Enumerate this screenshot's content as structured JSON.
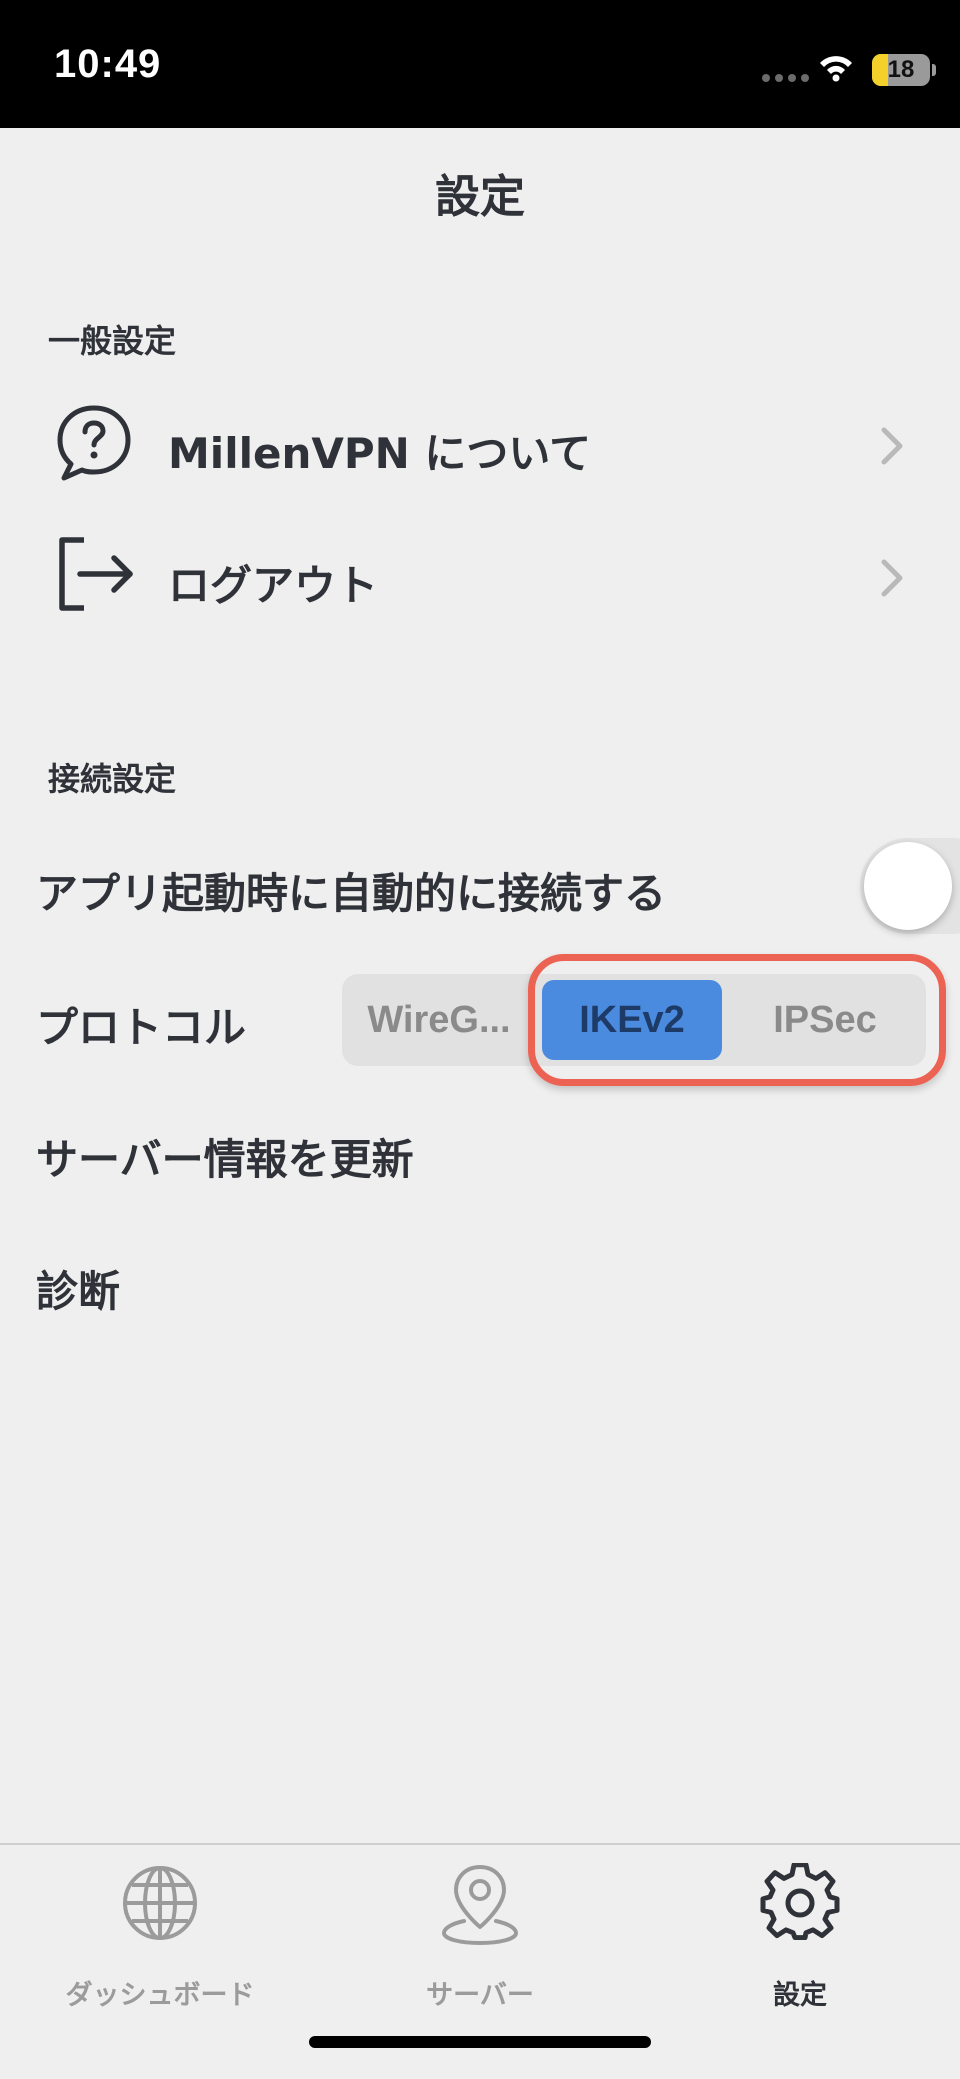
{
  "status_bar": {
    "time": "10:49",
    "battery": "18"
  },
  "header": {
    "title": "設定"
  },
  "general": {
    "section_label": "一般設定",
    "items": [
      {
        "label": "MillenVPN について",
        "icon": "help-bubble-icon"
      },
      {
        "label": "ログアウト",
        "icon": "logout-icon"
      }
    ]
  },
  "connection": {
    "section_label": "接続設定",
    "auto_connect_label": "アプリ起動時に自動的に接続する",
    "auto_connect_on": false,
    "protocol_label": "プロトコル",
    "protocol_options": [
      "WireG...",
      "IKEv2",
      "IPSec"
    ],
    "protocol_selected": "IKEv2",
    "refresh_label": "サーバー情報を更新",
    "diagnose_label": "診断"
  },
  "tab_bar": {
    "tabs": [
      {
        "label": "ダッシュボード",
        "icon": "globe-icon",
        "active": false
      },
      {
        "label": "サーバー",
        "icon": "map-pin-icon",
        "active": false
      },
      {
        "label": "設定",
        "icon": "gear-icon",
        "active": true
      }
    ]
  },
  "colors": {
    "accent": "#4a8be0",
    "highlight": "#ec6253",
    "background": "#efefef",
    "text": "#2f3238",
    "inactive": "#9b9b9b"
  }
}
